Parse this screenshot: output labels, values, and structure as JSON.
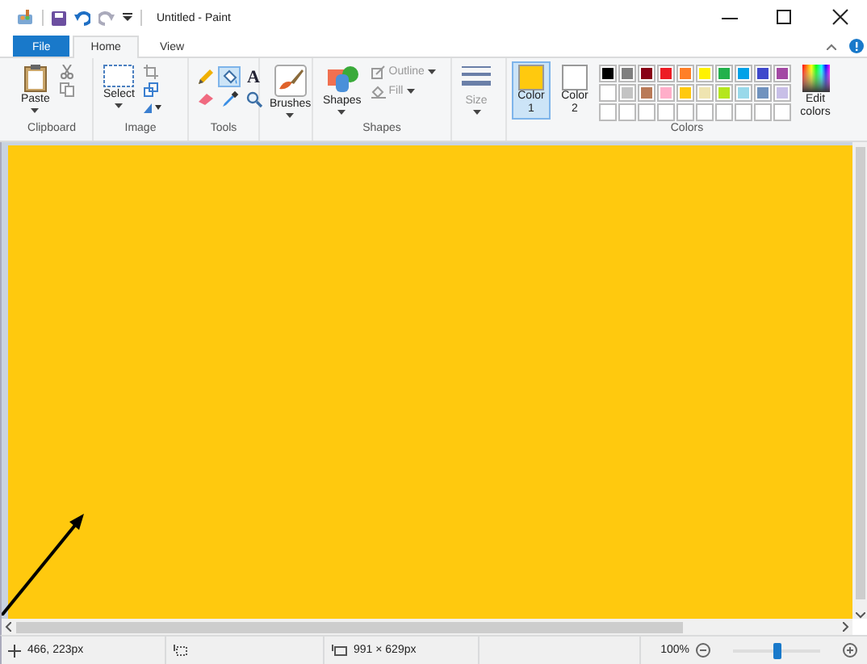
{
  "window": {
    "title": "Untitled - Paint"
  },
  "tabs": [
    {
      "label": "File",
      "kind": "file",
      "selected": false
    },
    {
      "label": "Home",
      "kind": "tab",
      "selected": true
    },
    {
      "label": "View",
      "kind": "tab",
      "selected": false
    }
  ],
  "clipboard": {
    "label": "Clipboard",
    "paste": "Paste"
  },
  "image": {
    "label": "Image",
    "select": "Select"
  },
  "tools": {
    "label": "Tools",
    "items": [
      {
        "kind": "pencil",
        "selected": false
      },
      {
        "kind": "fill",
        "selected": true
      },
      {
        "kind": "text",
        "glyph": "A",
        "selected": false
      },
      {
        "kind": "eraser",
        "selected": false
      },
      {
        "kind": "picker",
        "selected": false
      },
      {
        "kind": "magnifier",
        "selected": false
      }
    ]
  },
  "brushes": {
    "label": "Brushes"
  },
  "shapes": {
    "label": "Shapes",
    "button": "Shapes",
    "outline": {
      "label": "Outline",
      "disabled": true
    },
    "fill": {
      "label": "Fill",
      "disabled": true
    }
  },
  "size": {
    "label": "Size",
    "disabled": true
  },
  "colors": {
    "label": "Colors",
    "slots": [
      {
        "label": "Color 1",
        "color": "#ffc90e",
        "selected": true
      },
      {
        "label": "Color 2",
        "color": "#ffffff",
        "selected": false
      }
    ],
    "palette": [
      {
        "color": "#000000"
      },
      {
        "color": "#7f7f7f"
      },
      {
        "color": "#880015"
      },
      {
        "color": "#ed1c24"
      },
      {
        "color": "#ff7f27"
      },
      {
        "color": "#fff200"
      },
      {
        "color": "#22b14c"
      },
      {
        "color": "#00a2e8"
      },
      {
        "color": "#3f48cc"
      },
      {
        "color": "#a349a4"
      },
      {
        "color": "#ffffff"
      },
      {
        "color": "#c3c3c3"
      },
      {
        "color": "#b97a57"
      },
      {
        "color": "#ffaec9"
      },
      {
        "color": "#ffc90e"
      },
      {
        "color": "#efe4b0"
      },
      {
        "color": "#b5e61d"
      },
      {
        "color": "#99d9ea"
      },
      {
        "color": "#7092be"
      },
      {
        "color": "#c8bfe7"
      }
    ],
    "edit": "Edit colors"
  },
  "status_bar": {
    "cursor": "466, 223px",
    "canvas_size": "991 × 629px",
    "zoom": "100%",
    "level": 0.5
  }
}
